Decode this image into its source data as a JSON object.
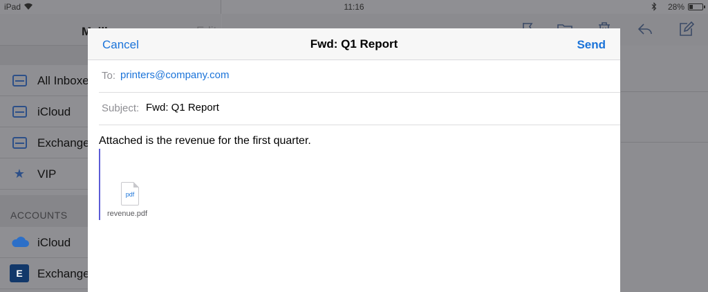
{
  "status_bar": {
    "carrier": "iPad",
    "time": "11:16",
    "battery_text": "28%",
    "battery_level": 0.28
  },
  "mailboxes": {
    "title": "Mailboxes",
    "edit_label": "Edit",
    "items": [
      {
        "label": "All Inboxes",
        "icon": "inbox-icon"
      },
      {
        "label": "iCloud",
        "icon": "inbox-icon"
      },
      {
        "label": "Exchange",
        "icon": "inbox-icon"
      },
      {
        "label": "VIP",
        "icon": "star-icon"
      }
    ],
    "accounts_header": "ACCOUNTS",
    "accounts": [
      {
        "label": "iCloud",
        "icon": "icloud-icon"
      },
      {
        "label": "Exchange",
        "icon": "exchange-icon"
      }
    ]
  },
  "message_toolbar": {
    "icons": [
      "flag-icon",
      "folder-icon",
      "trash-icon",
      "reply-icon",
      "compose-icon"
    ]
  },
  "compose": {
    "cancel_label": "Cancel",
    "title": "Fwd: Q1 Report",
    "send_label": "Send",
    "to_label": "To:",
    "to_value": "printers@company.com",
    "subject_label": "Subject:",
    "subject_value": "Fwd: Q1 Report",
    "body": "Attached is the revenue for the first quarter.",
    "attachment": {
      "icon_label": "pdf",
      "filename": "revenue.pdf"
    }
  },
  "colors": {
    "accent": "#1a73d9",
    "quote_bar": "#5b5bd6",
    "dimmed_background": "#8f8f93"
  }
}
